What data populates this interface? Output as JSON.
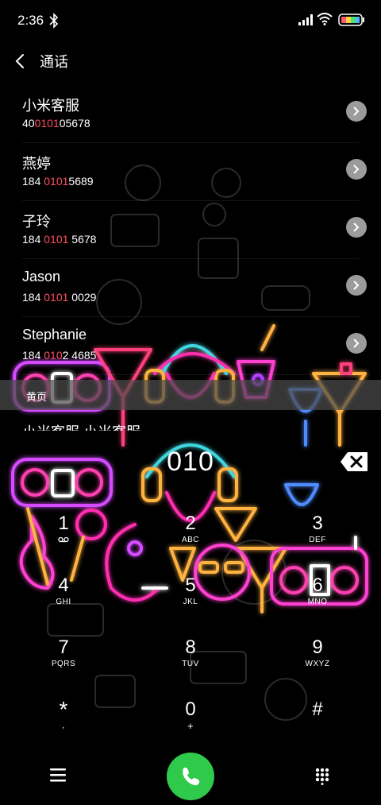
{
  "status_bar": {
    "time": "2:36",
    "icons": [
      "bluetooth-icon",
      "signal-icon",
      "wifi-icon",
      "battery-icon"
    ]
  },
  "header": {
    "back_icon": "chevron-left-icon",
    "title": "通话"
  },
  "contacts": [
    {
      "name": "小米客服",
      "number_parts": [
        "40",
        "0101",
        "05678"
      ]
    },
    {
      "name": "燕婷",
      "number_parts": [
        "184 ",
        "0101",
        "5689"
      ]
    },
    {
      "name": "子玲",
      "number_parts": [
        "184 ",
        "0101",
        " 5678"
      ]
    },
    {
      "name": "Jason",
      "number_parts": [
        "184 ",
        "0101",
        " 0029"
      ]
    },
    {
      "name": "Stephanie",
      "number_parts": [
        "184 ",
        "010",
        "2 4685"
      ]
    }
  ],
  "yellow_pages": {
    "label": "黄页",
    "partial_item": "小米客服 小米客服"
  },
  "dialpad": {
    "display": "010",
    "keys": [
      {
        "digit": "1",
        "letters": "",
        "voicemail": true
      },
      {
        "digit": "2",
        "letters": "ABC"
      },
      {
        "digit": "3",
        "letters": "DEF"
      },
      {
        "digit": "4",
        "letters": "GHI"
      },
      {
        "digit": "5",
        "letters": "JKL"
      },
      {
        "digit": "6",
        "letters": "MNO"
      },
      {
        "digit": "7",
        "letters": "PQRS"
      },
      {
        "digit": "8",
        "letters": "TUV"
      },
      {
        "digit": "9",
        "letters": "WXYZ"
      },
      {
        "digit": "*",
        "letters": ","
      },
      {
        "digit": "0",
        "letters": "+"
      },
      {
        "digit": "#",
        "letters": ""
      }
    ]
  },
  "bottom_bar": {
    "menu_icon": "hamburger-menu-icon",
    "call_icon": "phone-icon",
    "keypad_icon": "dialpad-grid-icon"
  },
  "colors": {
    "highlight": "#ff4d5e",
    "call_green": "#2fc94b",
    "section_bg": "#4b4b4b"
  }
}
